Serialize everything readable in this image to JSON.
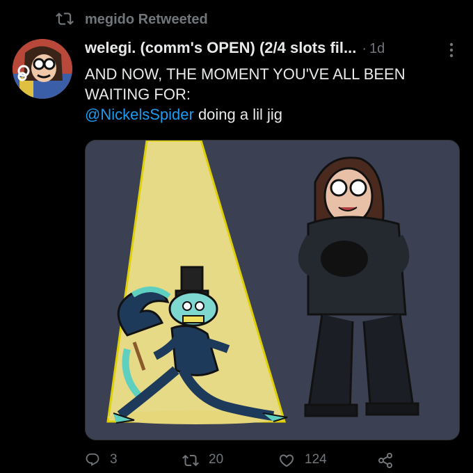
{
  "retweet_banner": {
    "text": "megido Retweeted",
    "icon": "retweet-icon"
  },
  "tweet": {
    "author": "welegi. (comm's OPEN) (2/4 slots fil...",
    "separator": "·",
    "time": "1d",
    "more_icon": "more-icon",
    "lines": [
      "AND NOW, THE MOMENT YOU'VE ALL BEEN",
      "WAITING FOR:"
    ],
    "mention": "@NickelsSpider",
    "mention_suffix": " doing a lil jig",
    "media_alt_icon": "artwork-image"
  },
  "actions": {
    "reply": {
      "count": "3",
      "icon": "reply-icon"
    },
    "retweet": {
      "count": "20",
      "icon": "retweet-icon"
    },
    "like": {
      "count": "124",
      "icon": "heart-icon"
    },
    "share": {
      "icon": "share-icon"
    }
  },
  "colors": {
    "background": "#000000",
    "text": "#e7e9ea",
    "muted": "#71767b",
    "link": "#1d9bf0",
    "media_bg": "#3b4152",
    "spotlight": "#f0e38a"
  }
}
